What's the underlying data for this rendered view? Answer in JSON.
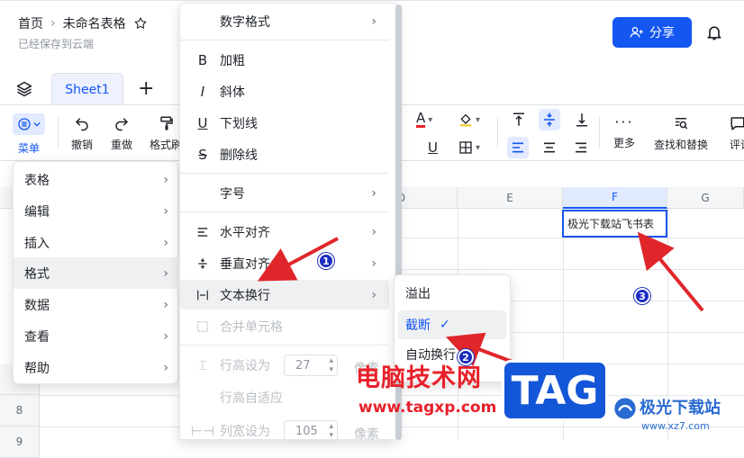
{
  "header": {
    "home": "首页",
    "doc_title": "未命名表格",
    "saved": "已经保存到云端",
    "share": "分享"
  },
  "tabs": {
    "sheet1": "Sheet1"
  },
  "toolbar": {
    "menu": "菜单",
    "undo": "撤销",
    "redo": "重做",
    "format_painter": "格式刷",
    "more": "更多",
    "find_replace": "查找和替换",
    "comment": "评论"
  },
  "grid": {
    "cols": [
      "D",
      "E",
      "F",
      "G"
    ],
    "rows": [
      "7",
      "8",
      "9"
    ],
    "cell_f": "极光下载站飞书表"
  },
  "main_menu": {
    "items": [
      "表格",
      "编辑",
      "插入",
      "格式",
      "数据",
      "查看",
      "帮助"
    ]
  },
  "format_menu": {
    "number_format": "数字格式",
    "bold": "加粗",
    "italic": "斜体",
    "underline": "下划线",
    "strikethrough": "删除线",
    "font_size": "字号",
    "h_align": "水平对齐",
    "v_align": "垂直对齐",
    "wrap": "文本换行",
    "merge": "合并单元格",
    "row_height": "行高设为",
    "row_height_value": "27",
    "row_height_unit": "像素",
    "row_auto": "行高自适应",
    "col_width": "列宽设为",
    "col_width_value": "105",
    "col_width_unit": "像素"
  },
  "wrap_menu": {
    "overflow": "溢出",
    "clip": "截断",
    "auto_wrap": "自动换行"
  },
  "annotations": {
    "b1": "1",
    "b2": "2",
    "b3": "3"
  },
  "watermark": {
    "site_cn": "电脑技术网",
    "site_url": "www.tagxp.com",
    "tag": "TAG",
    "brand": "极光下载站",
    "brand_url": "www.xz7.com"
  },
  "colors": {
    "accent": "#1456f0",
    "arrow": "#e0262b",
    "badge": "#1b2ec1"
  }
}
